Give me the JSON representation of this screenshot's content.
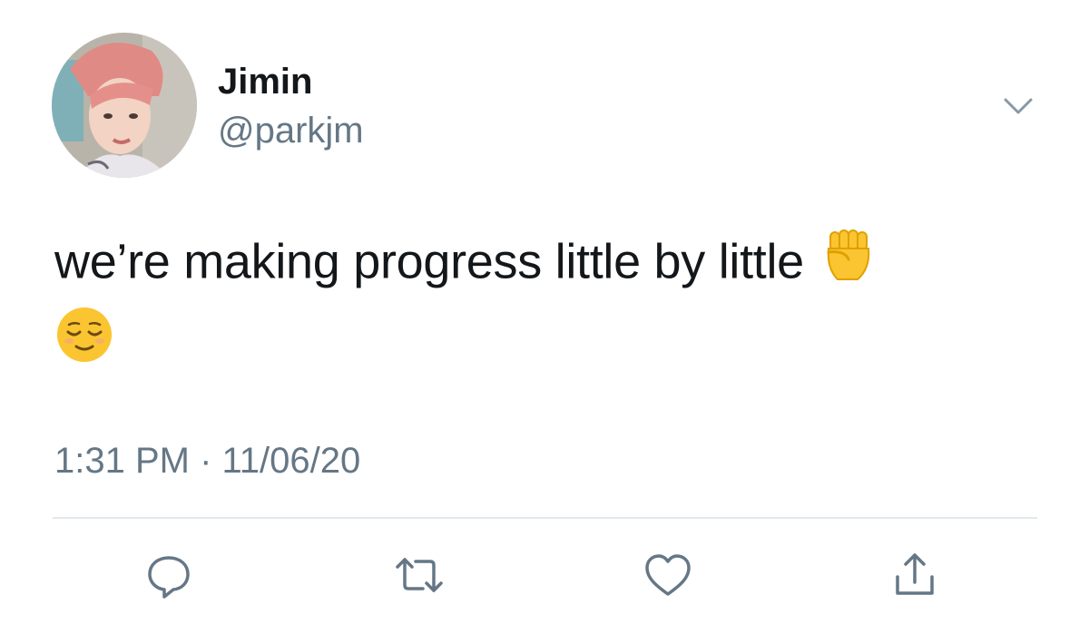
{
  "tweet": {
    "display_name": "Jimin",
    "handle": "@parkjm",
    "text_before": "we’re making progress little by little ",
    "timestamp": "1:31 PM · 11/06/20"
  },
  "icons": {
    "menu": "chevron-down-icon",
    "reply": "reply-icon",
    "retweet": "retweet-icon",
    "like": "heart-icon",
    "share": "share-icon",
    "emoji_1": "raised-fist-emoji",
    "emoji_2": "relieved-face-emoji"
  },
  "colors": {
    "text": "#14171a",
    "secondary": "#657786",
    "divider": "#e1e8ed",
    "emoji_yellow": "#fbc531"
  }
}
